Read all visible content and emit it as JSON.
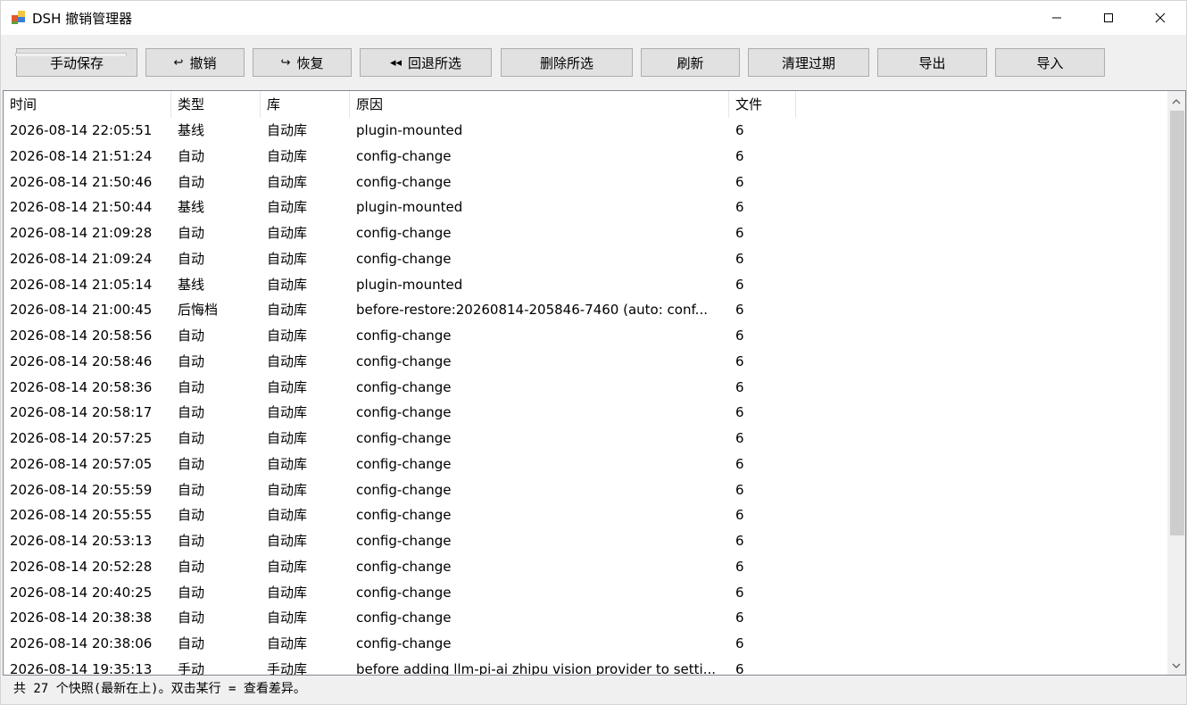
{
  "window": {
    "title": "DSH 撤销管理器",
    "icon": "app-windows-icon",
    "controls": [
      "minimize-icon",
      "maximize-icon",
      "close-icon"
    ]
  },
  "toolbar": {
    "buttons": [
      {
        "label": "手动保存",
        "icon": ""
      },
      {
        "label": "撤销",
        "icon": "↩"
      },
      {
        "label": "恢复",
        "icon": "↪"
      },
      {
        "label": "回退所选",
        "icon": "◂◂"
      },
      {
        "label": "删除所选",
        "icon": ""
      },
      {
        "label": "刷新",
        "icon": ""
      },
      {
        "label": "清理过期",
        "icon": ""
      },
      {
        "label": "导出",
        "icon": ""
      },
      {
        "label": "导入",
        "icon": ""
      }
    ]
  },
  "list": {
    "columns": [
      "时间",
      "类型",
      "库",
      "原因",
      "文件"
    ],
    "rows": [
      [
        "2026-08-14 22:05:51",
        "基线",
        "自动库",
        "plugin-mounted",
        "6"
      ],
      [
        "2026-08-14 21:51:24",
        "自动",
        "自动库",
        "config-change",
        "6"
      ],
      [
        "2026-08-14 21:50:46",
        "自动",
        "自动库",
        "config-change",
        "6"
      ],
      [
        "2026-08-14 21:50:44",
        "基线",
        "自动库",
        "plugin-mounted",
        "6"
      ],
      [
        "2026-08-14 21:09:28",
        "自动",
        "自动库",
        "config-change",
        "6"
      ],
      [
        "2026-08-14 21:09:24",
        "自动",
        "自动库",
        "config-change",
        "6"
      ],
      [
        "2026-08-14 21:05:14",
        "基线",
        "自动库",
        "plugin-mounted",
        "6"
      ],
      [
        "2026-08-14 21:00:45",
        "后悔档",
        "自动库",
        "before-restore:20260814-205846-7460 (auto: conf...",
        "6"
      ],
      [
        "2026-08-14 20:58:56",
        "自动",
        "自动库",
        "config-change",
        "6"
      ],
      [
        "2026-08-14 20:58:46",
        "自动",
        "自动库",
        "config-change",
        "6"
      ],
      [
        "2026-08-14 20:58:36",
        "自动",
        "自动库",
        "config-change",
        "6"
      ],
      [
        "2026-08-14 20:58:17",
        "自动",
        "自动库",
        "config-change",
        "6"
      ],
      [
        "2026-08-14 20:57:25",
        "自动",
        "自动库",
        "config-change",
        "6"
      ],
      [
        "2026-08-14 20:57:05",
        "自动",
        "自动库",
        "config-change",
        "6"
      ],
      [
        "2026-08-14 20:55:59",
        "自动",
        "自动库",
        "config-change",
        "6"
      ],
      [
        "2026-08-14 20:55:55",
        "自动",
        "自动库",
        "config-change",
        "6"
      ],
      [
        "2026-08-14 20:53:13",
        "自动",
        "自动库",
        "config-change",
        "6"
      ],
      [
        "2026-08-14 20:52:28",
        "自动",
        "自动库",
        "config-change",
        "6"
      ],
      [
        "2026-08-14 20:40:25",
        "自动",
        "自动库",
        "config-change",
        "6"
      ],
      [
        "2026-08-14 20:38:38",
        "自动",
        "自动库",
        "config-change",
        "6"
      ],
      [
        "2026-08-14 20:38:06",
        "自动",
        "自动库",
        "config-change",
        "6"
      ],
      [
        "2026-08-14 19:35:13",
        "手动",
        "手动库",
        "before adding llm-pi-ai zhipu vision provider to setti...",
        "6"
      ]
    ]
  },
  "status": {
    "text": "共 27 个快照(最新在上)。双击某行 = 查看差异。"
  }
}
